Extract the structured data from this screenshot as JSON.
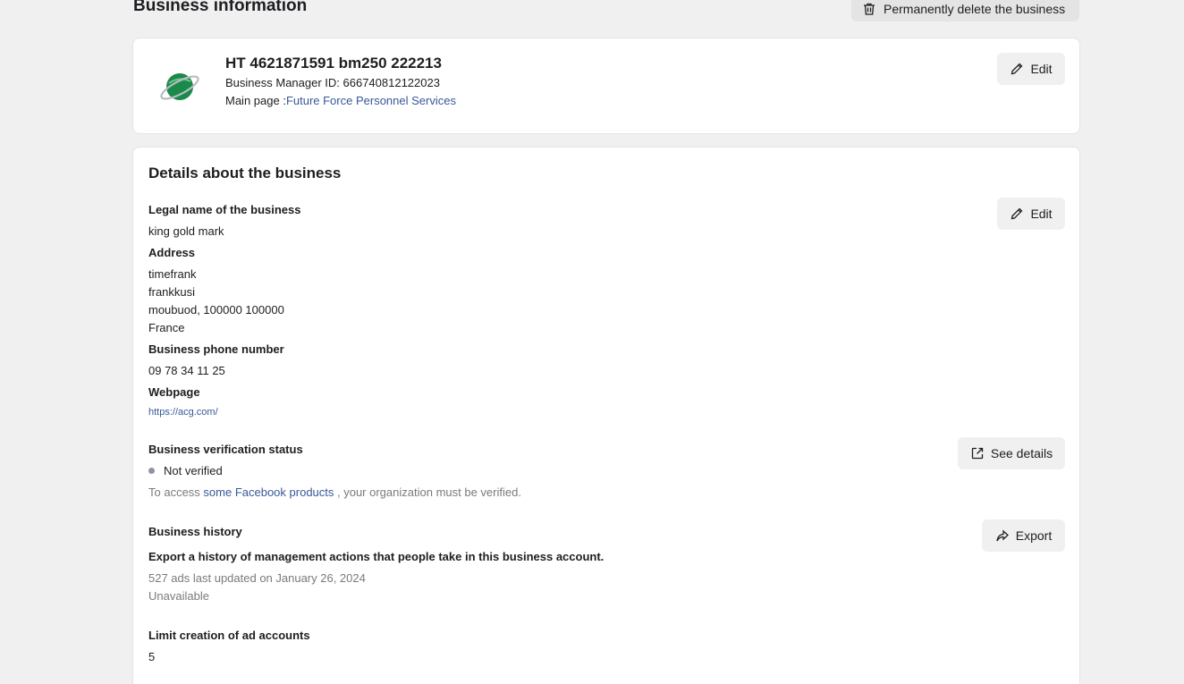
{
  "header": {
    "title": "Business information",
    "delete_label": "Permanently delete the business"
  },
  "business": {
    "name": "HT 4621871591 bm250 222213",
    "manager_id": "Business Manager ID: 666740812122023",
    "main_page_prefix": "Main page :",
    "main_page_link": "Future Force Personnel Services",
    "edit_label": "Edit"
  },
  "details": {
    "title": "Details about the business",
    "edit_label": "Edit",
    "legal_name_label": "Legal name of the business",
    "legal_name": "king gold mark",
    "address_label": "Address",
    "address_lines": [
      "timefrank",
      "frankkusi",
      "moubuod, 100000 100000",
      "France"
    ],
    "phone_label": "Business phone number",
    "phone": "09 78 34 11 25",
    "webpage_label": "Webpage",
    "webpage": "https://acg.com/",
    "verification_label": "Business verification status",
    "verification_status": "Not verified",
    "see_details_label": "See details",
    "verify_note_prefix": "To access ",
    "verify_note_link": "some Facebook products",
    "verify_note_suffix": " , your organization must be verified.",
    "history_label": "Business history",
    "export_label": "Export",
    "history_desc": "Export a history of management actions that people take in this business account.",
    "history_updated": "527 ads last updated on January 26, 2024",
    "history_status": "Unavailable",
    "limit_label": "Limit creation of ad accounts",
    "limit_value": "5"
  },
  "colors": {
    "link": "#385898",
    "logo_green": "#1a8a4a"
  }
}
